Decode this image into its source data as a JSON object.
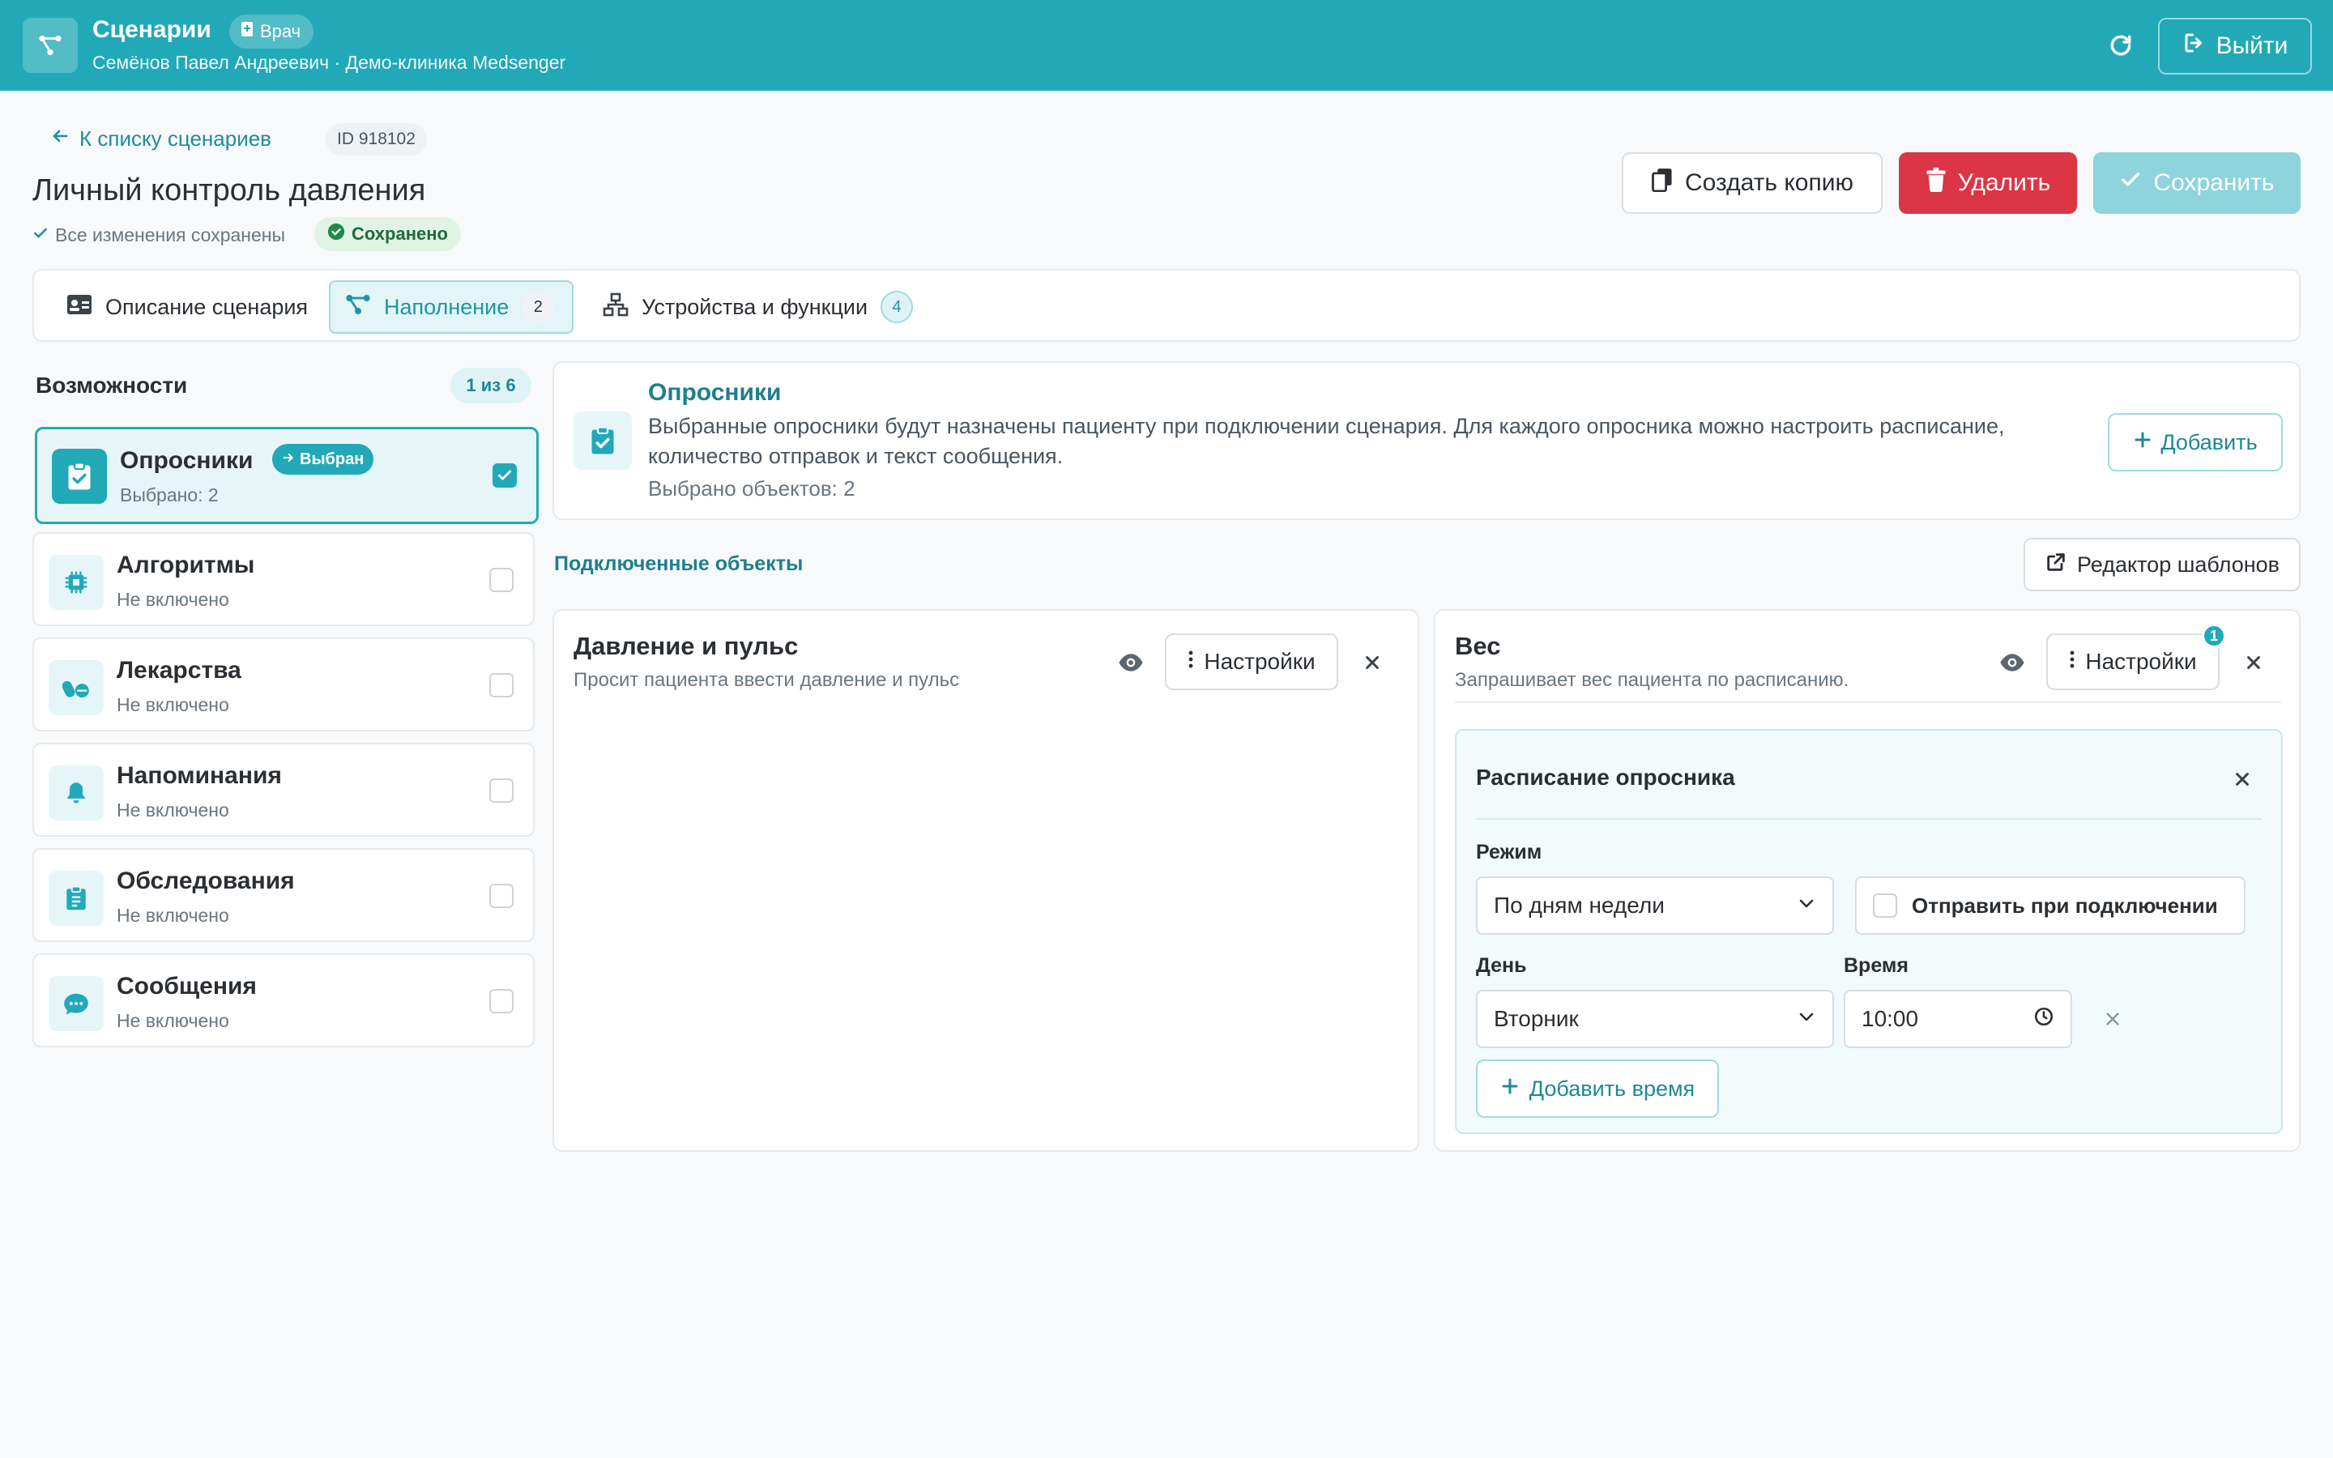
{
  "header": {
    "app_title": "Сценарии",
    "role_badge": "Врач",
    "subtitle": "Семёнов Павел Андреевич · Демо-клиника Medsenger",
    "logout_label": "Выйти",
    "brand_color": "#22a9b8"
  },
  "page": {
    "back_label": "К списку сценариев",
    "id_badge": "ID 918102",
    "title": "Личный контроль давления",
    "save_note": "Все изменения сохранены",
    "saved_pill": "Сохранено",
    "copy_label": "Создать копию",
    "delete_label": "Удалить",
    "save_label": "Сохранить"
  },
  "tabs": [
    {
      "label": "Описание сценария",
      "icon": "id-card-icon"
    },
    {
      "label": "Наполнение",
      "count": "2",
      "icon": "nodes-icon",
      "active": true
    },
    {
      "label": "Устройства и функции",
      "count": "4",
      "icon": "network-icon"
    }
  ],
  "capabilities": {
    "title": "Возможности",
    "count": "1 из 6",
    "items": [
      {
        "name": "Опросники",
        "sub": "Выбрано: 2",
        "badge": "Выбран",
        "icon": "clipboard-check-icon",
        "active": true
      },
      {
        "name": "Алгоритмы",
        "sub": "Не включено",
        "icon": "chip-icon"
      },
      {
        "name": "Лекарства",
        "sub": "Не включено",
        "icon": "pills-icon"
      },
      {
        "name": "Напоминания",
        "sub": "Не включено",
        "icon": "bell-icon"
      },
      {
        "name": "Обследования",
        "sub": "Не включено",
        "icon": "clipboard-list-icon"
      },
      {
        "name": "Сообщения",
        "sub": "Не включено",
        "icon": "chat-icon"
      }
    ]
  },
  "info": {
    "title": "Опросники",
    "description": "Выбранные опросники будут назначены пациенту при подключении сценария. Для каждого опросника можно настроить расписание, количество отправок и текст сообщения.",
    "count": "Выбрано объектов: 2",
    "add_label": "Добавить"
  },
  "connected": {
    "label": "Подключенные объекты",
    "template_editor": "Редактор шаблонов"
  },
  "objects": [
    {
      "title": "Давление и пульс",
      "desc": "Просит пациента ввести давление и пульс",
      "settings": "Настройки"
    },
    {
      "title": "Вес",
      "desc": "Запрашивает вес пациента по расписанию.",
      "settings": "Настройки",
      "notif": "1"
    }
  ],
  "schedule": {
    "title": "Расписание опросника",
    "mode_label": "Режим",
    "mode_value": "По дням недели",
    "send_on_connect": "Отправить при подключении",
    "day_label": "День",
    "day_value": "Вторник",
    "time_label": "Время",
    "time_value": "10:00",
    "add_time": "Добавить время"
  }
}
